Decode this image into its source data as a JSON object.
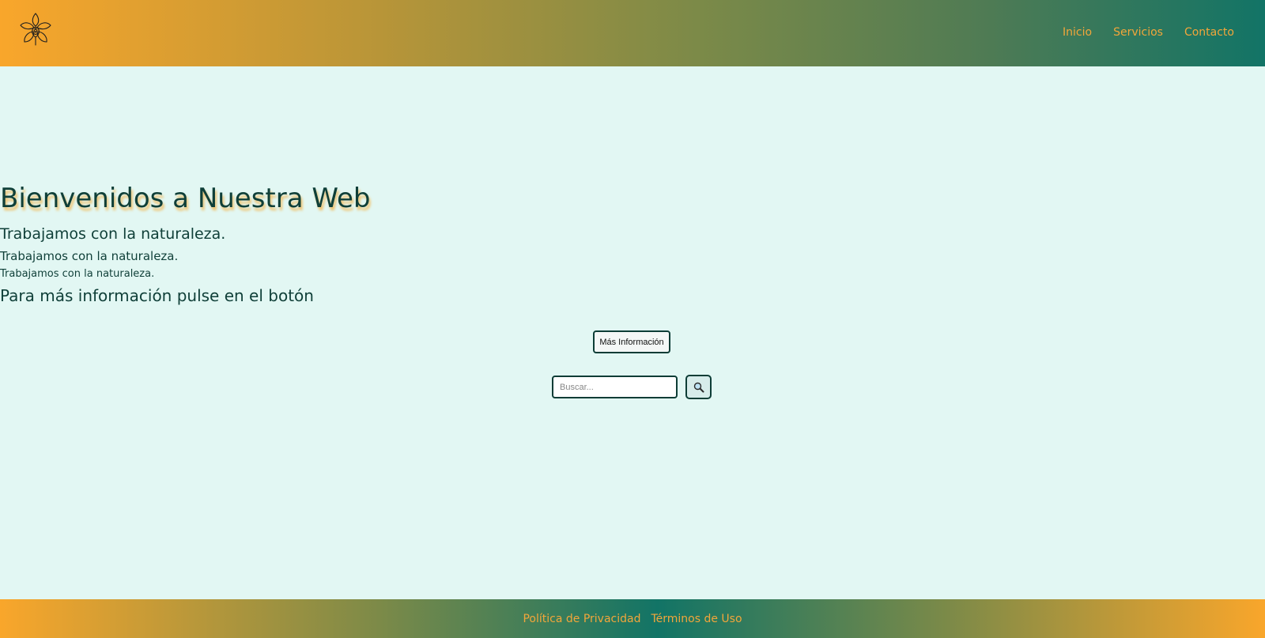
{
  "header": {
    "logo_icon": "orchid-flower-icon",
    "nav": [
      {
        "label": "Inicio"
      },
      {
        "label": "Servicios"
      },
      {
        "label": "Contacto"
      }
    ]
  },
  "hero": {
    "title": "Bienvenidos a Nuestra Web",
    "subtitle_large": "Trabajamos con la naturaleza.",
    "subtitle_medium": "Trabajamos con la naturaleza.",
    "subtitle_small": "Trabajamos con la naturaleza.",
    "info_text": "Para más información pulse en el botón",
    "button_label": "Más Información"
  },
  "search": {
    "placeholder": "Buscar...",
    "value": "",
    "button_icon": "magnifier-icon"
  },
  "footer": {
    "links": [
      {
        "label": "Política de Privacidad"
      },
      {
        "label": "Términos de Uso"
      }
    ]
  },
  "colors": {
    "header_gradient_start": "#f9a62b",
    "header_gradient_end": "#127466",
    "main_background": "#e2f7f3",
    "text_dark": "#0f3f38",
    "link_orange": "#f2a63a",
    "title_shadow": "#efc06a"
  }
}
